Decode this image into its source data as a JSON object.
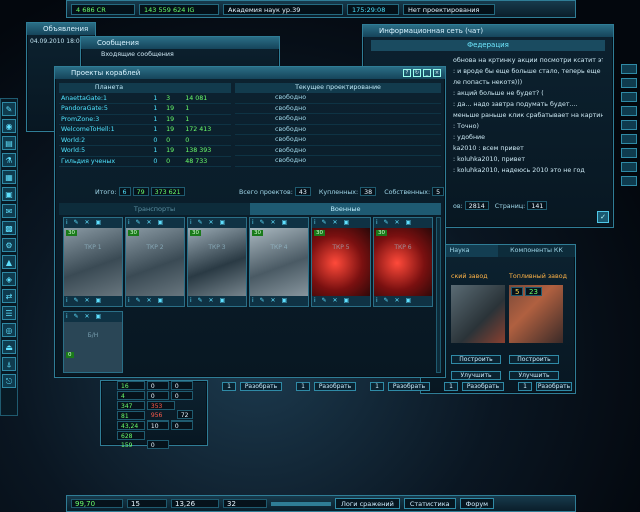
{
  "topbar": {
    "credits": "4 686 CR",
    "energy": "143 559 624 IG",
    "research": "Академия наук ур.39",
    "time": "175:29:08",
    "status": "Нет проектирования"
  },
  "announcements": {
    "title": "Объявления",
    "date": "04.09.2010 18:00"
  },
  "messages": {
    "title": "Сообщения",
    "inbox": "Входящие сообщения"
  },
  "chat": {
    "title": "Информационная сеть (чат)",
    "channel": "Федерация",
    "lines": [
      "обнова на кртинку акции посмотри ксатит эта",
      ": и вроде бы еще больше стало, теперь еще",
      "ле попасть некотя)))",
      ": акций больше не будет? (",
      ": да... надо завтра подумать будет....",
      "меньше раньше клик срабатывает на картинку",
      ": Точно)",
      ": удобние",
      "ka2010 : всем привет",
      ": koluhka2010, привет",
      ": koluhka2010, надеюсь 2010 это не год"
    ],
    "footer_label": "ов:",
    "footer_count": "2814",
    "pages_label": "Страниц:",
    "pages": "141"
  },
  "projects": {
    "title": "Проекты кораблей",
    "col_planet": "Планета",
    "col_current": "Текущее проектирование",
    "planets": [
      {
        "name": "AnaettaGate:1",
        "a": "1",
        "b": "3",
        "c": "14 081"
      },
      {
        "name": "PandoraGate:5",
        "a": "1",
        "b": "19",
        "c": "1"
      },
      {
        "name": "PromZone:3",
        "a": "1",
        "b": "19",
        "c": "1"
      },
      {
        "name": "WelcomeToHell:1",
        "a": "1",
        "b": "19",
        "c": "172 413"
      },
      {
        "name": "World:2",
        "a": "0",
        "b": "0",
        "c": "0"
      },
      {
        "name": "World:5",
        "a": "1",
        "b": "19",
        "c": "138 393"
      },
      {
        "name": "Гильдия ученых",
        "a": "0",
        "b": "0",
        "c": "48 733"
      }
    ],
    "free": "свободно",
    "total_label": "Итого:",
    "total_a": "6",
    "total_b": "79",
    "total_c": "373 621",
    "total_projects_label": "Всего проектов:",
    "total_projects": "43",
    "bought_label": "Купленных:",
    "bought": "38",
    "own_label": "Собственных:",
    "own": "5",
    "tab_transport": "Транспорты",
    "tab_military": "Военные",
    "ships": [
      {
        "level": "30",
        "name": "ТКР 1",
        "img": "gray"
      },
      {
        "level": "30",
        "name": "ТКР 2",
        "img": "gray"
      },
      {
        "level": "30",
        "name": "ТКР 3",
        "img": "gray"
      },
      {
        "level": "30",
        "name": "ТКР 4",
        "img": "gray"
      },
      {
        "level": "30",
        "name": "ТКР 5",
        "img": "red"
      },
      {
        "level": "30",
        "name": "ТКР 6",
        "img": "red"
      },
      {
        "level": "0",
        "name": "Б/Н",
        "img": "empty"
      }
    ]
  },
  "buildings": {
    "tab_science": "Наука",
    "tab_components": "Компоненты КК",
    "plant": "ский завод",
    "fuel_plant": "Топливный завод",
    "fuel_a": "5",
    "fuel_b": "23",
    "build": "Построить",
    "upgrade": "Улучшить",
    "dismantle": "Разобрать",
    "count": "1"
  },
  "stats": {
    "rows": [
      {
        "v1": "16",
        "v2": "0",
        "v3": "0"
      },
      {
        "v1": "4",
        "v2": "0",
        "v3": "0"
      },
      {
        "v1": "347 832",
        "v2": "353 956",
        "v3": "72"
      },
      {
        "v1": "81 020",
        "v2": "0",
        "v3": "0"
      },
      {
        "v1": "43,24",
        "v2": "10",
        "v3": "0"
      },
      {
        "v1": "628 159",
        "v2": "0",
        "v3": ""
      }
    ]
  },
  "bottombar": {
    "v1": "99,70",
    "v2": "15",
    "v3": "13,26",
    "v4": "32",
    "battle_logs": "Логи сражений",
    "statistics": "Статистика",
    "forum": "Форум"
  },
  "colors": {
    "accent": "#4fe3ff",
    "panel": "#0c2230",
    "border": "#2f7d96",
    "level": "#1a7a1a"
  }
}
